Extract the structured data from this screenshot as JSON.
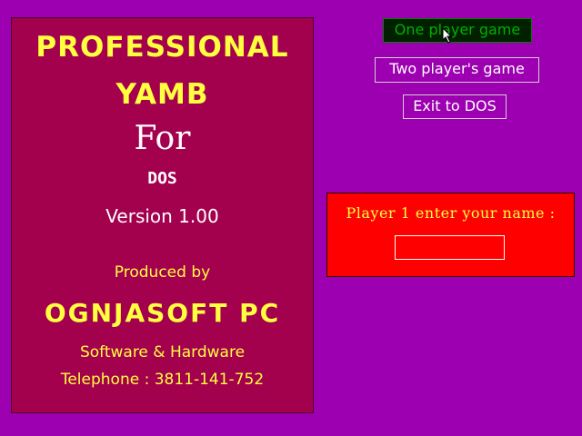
{
  "title_panel": {
    "line1": "PROFESSIONAL",
    "line2": "YAMB",
    "line3": "For",
    "line4": "DOS",
    "version": "Version 1.00",
    "produced_by": "Produced by",
    "company": "OGNJASOFT PC",
    "tagline": "Software & Hardware",
    "telephone": "Telephone : 3811-141-752"
  },
  "menu": {
    "items": [
      {
        "label": "One player game",
        "selected": true
      },
      {
        "label": "Two player's game",
        "selected": false
      },
      {
        "label": "Exit to DOS",
        "selected": false
      }
    ]
  },
  "name_dialog": {
    "prompt": "Player 1 enter your name :",
    "value": ""
  },
  "colors": {
    "background": "#9c00b0",
    "panel": "#a3004e",
    "title_text": "#ffff40",
    "dialog": "#ff0000",
    "selected_bg": "#002000",
    "selected_text": "#00b000"
  },
  "icons": [
    "mouse-pointer-icon"
  ]
}
